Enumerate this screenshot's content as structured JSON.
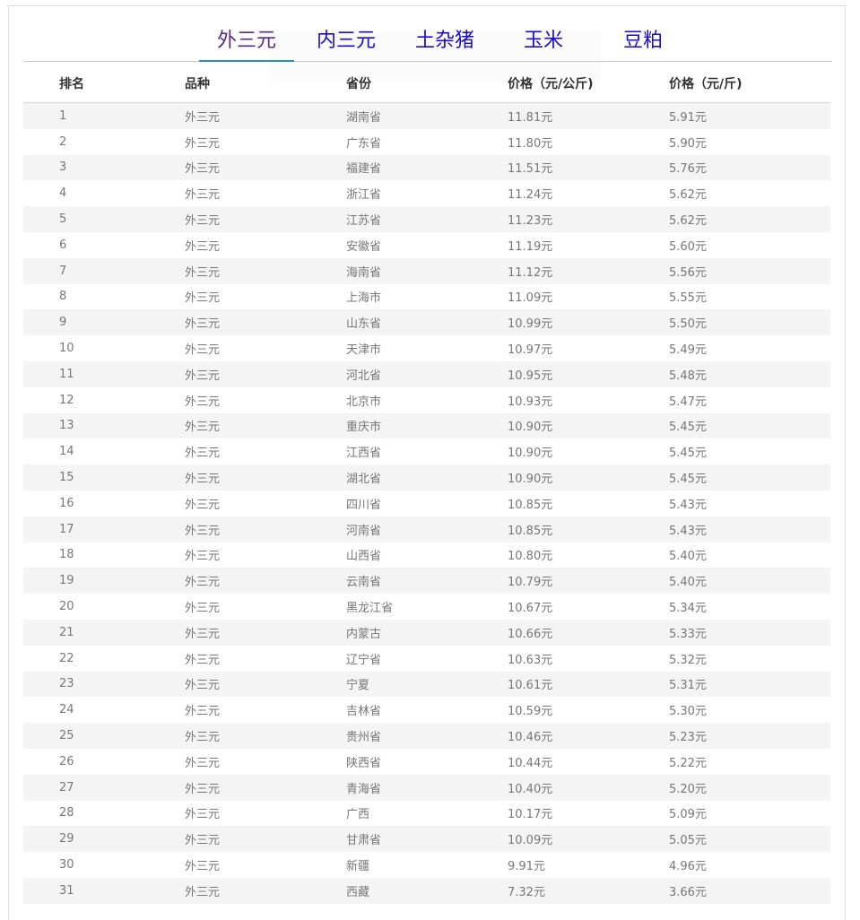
{
  "tabs": [
    {
      "label": "外三元",
      "active": true
    },
    {
      "label": "内三元",
      "active": false
    },
    {
      "label": "土杂猪",
      "active": false
    },
    {
      "label": "玉米",
      "active": false
    },
    {
      "label": "豆粕",
      "active": false
    }
  ],
  "table": {
    "headers": [
      "排名",
      "品种",
      "省份",
      "价格（元/公斤)",
      "价格（元/斤)"
    ],
    "rows": [
      [
        "1",
        "外三元",
        "湖南省",
        "11.81元",
        "5.91元"
      ],
      [
        "2",
        "外三元",
        "广东省",
        "11.80元",
        "5.90元"
      ],
      [
        "3",
        "外三元",
        "福建省",
        "11.51元",
        "5.76元"
      ],
      [
        "4",
        "外三元",
        "浙江省",
        "11.24元",
        "5.62元"
      ],
      [
        "5",
        "外三元",
        "江苏省",
        "11.23元",
        "5.62元"
      ],
      [
        "6",
        "外三元",
        "安徽省",
        "11.19元",
        "5.60元"
      ],
      [
        "7",
        "外三元",
        "海南省",
        "11.12元",
        "5.56元"
      ],
      [
        "8",
        "外三元",
        "上海市",
        "11.09元",
        "5.55元"
      ],
      [
        "9",
        "外三元",
        "山东省",
        "10.99元",
        "5.50元"
      ],
      [
        "10",
        "外三元",
        "天津市",
        "10.97元",
        "5.49元"
      ],
      [
        "11",
        "外三元",
        "河北省",
        "10.95元",
        "5.48元"
      ],
      [
        "12",
        "外三元",
        "北京市",
        "10.93元",
        "5.47元"
      ],
      [
        "13",
        "外三元",
        "重庆市",
        "10.90元",
        "5.45元"
      ],
      [
        "14",
        "外三元",
        "江西省",
        "10.90元",
        "5.45元"
      ],
      [
        "15",
        "外三元",
        "湖北省",
        "10.90元",
        "5.45元"
      ],
      [
        "16",
        "外三元",
        "四川省",
        "10.85元",
        "5.43元"
      ],
      [
        "17",
        "外三元",
        "河南省",
        "10.85元",
        "5.43元"
      ],
      [
        "18",
        "外三元",
        "山西省",
        "10.80元",
        "5.40元"
      ],
      [
        "19",
        "外三元",
        "云南省",
        "10.79元",
        "5.40元"
      ],
      [
        "20",
        "外三元",
        "黑龙江省",
        "10.67元",
        "5.34元"
      ],
      [
        "21",
        "外三元",
        "内蒙古",
        "10.66元",
        "5.33元"
      ],
      [
        "22",
        "外三元",
        "辽宁省",
        "10.63元",
        "5.32元"
      ],
      [
        "23",
        "外三元",
        "宁夏",
        "10.61元",
        "5.31元"
      ],
      [
        "24",
        "外三元",
        "吉林省",
        "10.59元",
        "5.30元"
      ],
      [
        "25",
        "外三元",
        "贵州省",
        "10.46元",
        "5.23元"
      ],
      [
        "26",
        "外三元",
        "陕西省",
        "10.44元",
        "5.22元"
      ],
      [
        "27",
        "外三元",
        "青海省",
        "10.40元",
        "5.20元"
      ],
      [
        "28",
        "外三元",
        "广西",
        "10.17元",
        "5.09元"
      ],
      [
        "29",
        "外三元",
        "甘肃省",
        "10.09元",
        "5.05元"
      ],
      [
        "30",
        "外三元",
        "新疆",
        "9.91元",
        "4.96元"
      ],
      [
        "31",
        "外三元",
        "西藏",
        "7.32元",
        "3.66元"
      ]
    ]
  },
  "colors": {
    "tab_text": "#1a0dcc",
    "tab_active_text": "#5a2a8a",
    "tab_underline": "#2a8ad0",
    "row_stripe": "#f4f4f4"
  }
}
